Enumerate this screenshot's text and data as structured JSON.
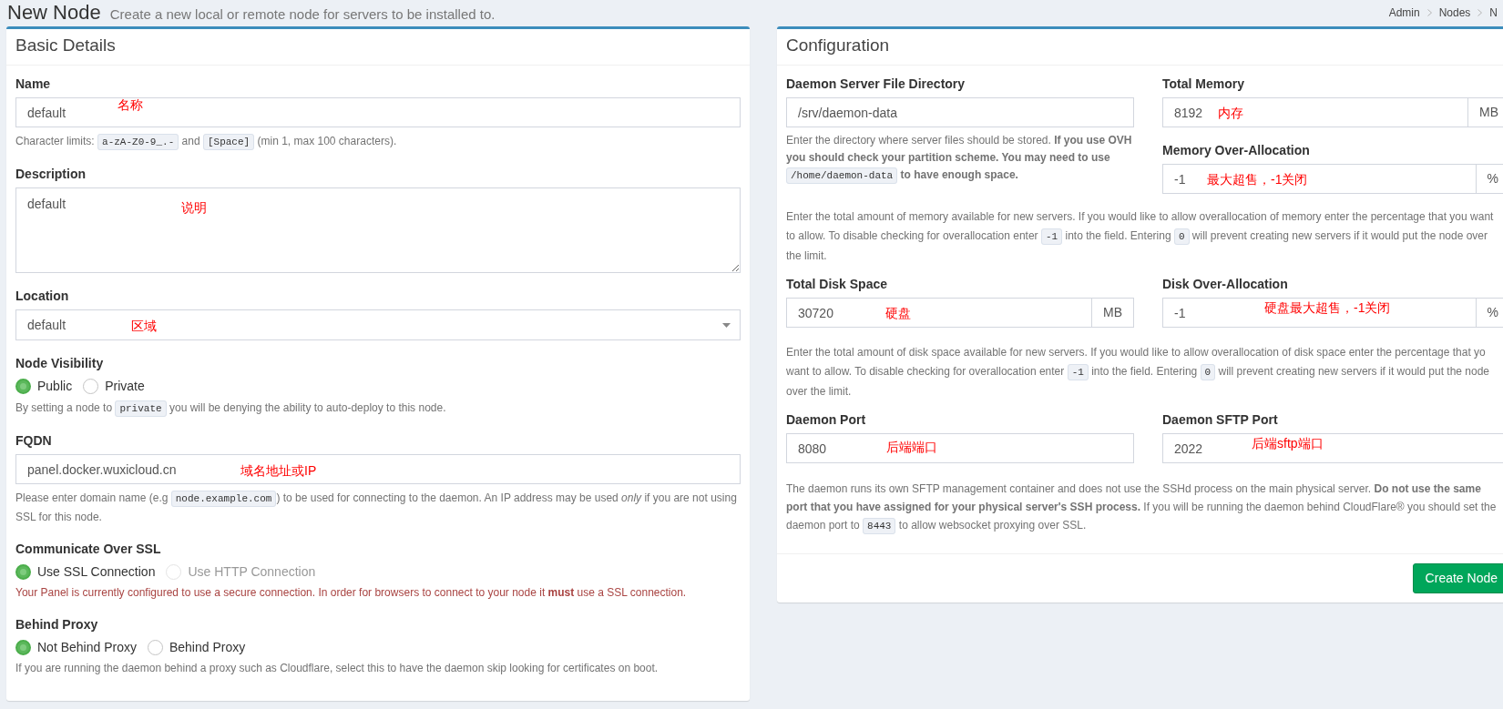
{
  "header": {
    "title": "New Node",
    "subtitle": "Create a new local or remote node for servers to be installed to.",
    "breadcrumb": [
      "Admin",
      "Nodes",
      "N"
    ]
  },
  "basic_details": {
    "title": "Basic Details",
    "name": {
      "label": "Name",
      "value": "default",
      "annotation": "名称",
      "help": [
        {
          "kind": "text",
          "text": "Character limits: "
        },
        {
          "kind": "code",
          "text": "a-zA-Z0-9_.-"
        },
        {
          "kind": "text",
          "text": " and "
        },
        {
          "kind": "code",
          "text": "[Space]"
        },
        {
          "kind": "text",
          "text": " (min 1, max 100 characters)."
        }
      ]
    },
    "description": {
      "label": "Description",
      "value": "default",
      "annotation": "说明"
    },
    "location": {
      "label": "Location",
      "value": "default",
      "annotation": "区域"
    },
    "node_visibility": {
      "label": "Node Visibility",
      "options": [
        {
          "label": "Public",
          "selected": true
        },
        {
          "label": "Private",
          "selected": false
        }
      ],
      "help": [
        {
          "kind": "text",
          "text": "By setting a node to "
        },
        {
          "kind": "code",
          "text": "private"
        },
        {
          "kind": "text",
          "text": " you will be denying the ability to auto-deploy to this node."
        }
      ]
    },
    "fqdn": {
      "label": "FQDN",
      "value": "panel.docker.wuxicloud.cn",
      "annotation": "域名地址或IP",
      "help": [
        {
          "kind": "text",
          "text": "Please enter domain name (e.g "
        },
        {
          "kind": "code",
          "text": "node.example.com"
        },
        {
          "kind": "text",
          "text": ") to be used for connecting to the daemon. An IP address may be used *only* if you are not using SSL for this node."
        }
      ]
    },
    "communicate_over_ssl": {
      "label": "Communicate Over SSL",
      "options": [
        {
          "label": "Use SSL Connection",
          "selected": true,
          "disabled": false
        },
        {
          "label": "Use HTTP Connection",
          "selected": false,
          "disabled": true
        }
      ],
      "warning": "Your Panel is currently configured to use a secure connection. In order for browsers to connect to your node it **must** use a SSL connection."
    },
    "behind_proxy": {
      "label": "Behind Proxy",
      "options": [
        {
          "label": "Not Behind Proxy",
          "selected": true
        },
        {
          "label": "Behind Proxy",
          "selected": false
        }
      ],
      "help": [
        {
          "kind": "text",
          "text": "If you are running the daemon behind a proxy such as Cloudflare, select this to have the daemon skip looking for certificates on boot."
        }
      ]
    }
  },
  "configuration": {
    "title": "Configuration",
    "daemon_directory": {
      "label": "Daemon Server File Directory",
      "value": "/srv/daemon-data",
      "help": [
        {
          "kind": "text",
          "text": "Enter the directory where server files should be stored. **If you use OVH you should check your partition scheme. You may need to use** "
        },
        {
          "kind": "code",
          "text": "/home/daemon-data"
        },
        {
          "kind": "text",
          "text": " **to have enough space.**"
        }
      ]
    },
    "total_memory": {
      "label": "Total Memory",
      "value": "8192",
      "unit": "MB",
      "annotation": "内存"
    },
    "memory_overallocation": {
      "label": "Memory Over-Allocation",
      "value": "-1",
      "unit": "%",
      "annotation": "最大超售，-1关闭"
    },
    "memory_help": [
      {
        "kind": "text",
        "text": "Enter the total amount of memory available for new servers. If you would like to allow overallocation of memory enter the percentage that you want to allow. To disable checking for overallocation enter "
      },
      {
        "kind": "code",
        "text": "-1"
      },
      {
        "kind": "text",
        "text": " into the field. Entering "
      },
      {
        "kind": "code",
        "text": "0"
      },
      {
        "kind": "text",
        "text": " will prevent creating new servers if it would put the node over the limit."
      }
    ],
    "total_disk": {
      "label": "Total Disk Space",
      "value": "30720",
      "unit": "MB",
      "annotation": "硬盘"
    },
    "disk_overallocation": {
      "label": "Disk Over-Allocation",
      "value": "-1",
      "unit": "%",
      "annotation": "硬盘最大超售，-1关闭"
    },
    "disk_help": [
      {
        "kind": "text",
        "text": "Enter the total amount of disk space available for new servers. If you would like to allow overallocation of disk space enter the percentage that yo want to allow. To disable checking for overallocation enter "
      },
      {
        "kind": "code",
        "text": "-1"
      },
      {
        "kind": "text",
        "text": " into the field. Entering "
      },
      {
        "kind": "code",
        "text": "0"
      },
      {
        "kind": "text",
        "text": " will prevent creating new servers if it would put the node over the limit."
      }
    ],
    "daemon_port": {
      "label": "Daemon Port",
      "value": "8080",
      "annotation": "后端端口"
    },
    "sftp_port": {
      "label": "Daemon SFTP Port",
      "value": "2022",
      "annotation": "后端sftp端口"
    },
    "port_help": [
      {
        "kind": "text",
        "text": "The daemon runs its own SFTP management container and does not use the SSHd process on the main physical server. **Do not use the same port that you have assigned for your physical server's SSH process.** If you will be running the daemon behind CloudFlare® you should set the daemon port to "
      },
      {
        "kind": "code",
        "text": "8443"
      },
      {
        "kind": "text",
        "text": " to allow websocket proxying over SSL."
      }
    ],
    "submit": "Create Node"
  }
}
